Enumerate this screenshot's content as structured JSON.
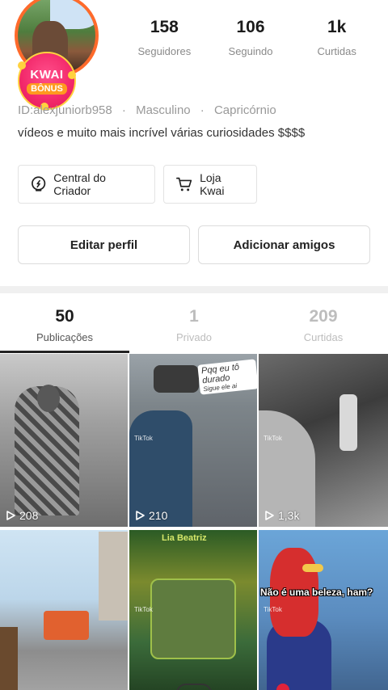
{
  "header": {
    "bonus": {
      "line1": "KWAI",
      "line2": "BÔNUS"
    },
    "stats": [
      {
        "value": "158",
        "label": "Seguidores"
      },
      {
        "value": "106",
        "label": "Seguindo"
      },
      {
        "value": "1k",
        "label": "Curtidas"
      }
    ]
  },
  "profile": {
    "id": "ID:alexjuniorb958",
    "gender": "Masculino",
    "sign": "Capricórnio",
    "separator": "·",
    "bio": "vídeos e muito mais incrível várias curiosidades $$$$"
  },
  "shortcuts": {
    "creator_center": "Central do Criador",
    "shop": "Loja Kwai"
  },
  "actions": {
    "edit_profile": "Editar perfil",
    "add_friends": "Adicionar amigos"
  },
  "tabs": [
    {
      "count": "50",
      "label": "Publicações"
    },
    {
      "count": "1",
      "label": "Privado"
    },
    {
      "count": "209",
      "label": "Curtidas"
    }
  ],
  "grid": {
    "items": [
      {
        "views": "208"
      },
      {
        "views": "210",
        "sticker": "Pqq eu tô durado",
        "sticker_sub": "Sigue ele ai"
      },
      {
        "views": "1,3k"
      },
      {
        "views": ""
      },
      {
        "views": "",
        "overlay": "Lia Beatriz"
      },
      {
        "views": "",
        "caption": "Não é uma beleza, ham?"
      }
    ],
    "tiktok_mark": "TikTok"
  },
  "colors": {
    "accent": "#ff6a2b",
    "bonus_bg": "#f2286a",
    "tab_active": "#222222",
    "tab_inactive": "#bdbdbd"
  },
  "icons": {
    "creator_center": "dollar-bulb-icon",
    "shop": "cart-icon",
    "play": "play-icon"
  }
}
